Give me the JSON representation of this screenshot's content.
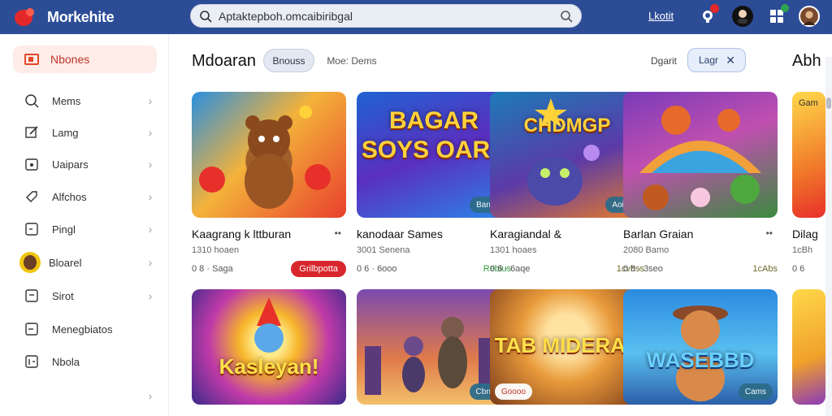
{
  "header": {
    "brand": "Morkehite",
    "search_value": "Aptaktepboh.omcaibiribgal",
    "link": "Lkotit"
  },
  "sidebar": {
    "active": "Nbones",
    "items": [
      {
        "label": "Mems",
        "icon": "search-icon"
      },
      {
        "label": "Lamg",
        "icon": "edit-icon"
      },
      {
        "label": "Uaipars",
        "icon": "calendar-icon"
      },
      {
        "label": "Alfchos",
        "icon": "tag-icon"
      },
      {
        "label": "Pingl",
        "icon": "square-icon"
      },
      {
        "label": "Bloarel",
        "icon": "avatar-icon"
      },
      {
        "label": "Sirot",
        "icon": "box-icon"
      },
      {
        "label": "Menegbiatos",
        "icon": "minus-box-icon"
      },
      {
        "label": "Nbola",
        "icon": "grid-icon"
      },
      {
        "label": "",
        "icon": ""
      }
    ]
  },
  "main": {
    "title": "Mdoaran",
    "chip_active": "Bnouss",
    "chip_plain": "Moe: Dems",
    "filter_label": "Dgarit",
    "filter_chip": "Lagr",
    "right_title": "Abh"
  },
  "cards": [
    {
      "name": "Kaagrang k lttburan",
      "sub": "1310 hoaen",
      "meta": "0 8 · Saga",
      "status": "Grilbpotta",
      "status_style": "btn",
      "tag": "",
      "word": "",
      "more": "••"
    },
    {
      "name": "kanodaar Sames",
      "sub": "3001 Senena",
      "meta": "0 6 · 6ooo",
      "status": "Reblus",
      "status_style": "green",
      "tag": "Barms",
      "word": "BAGAR SOYS OARS",
      "more": ""
    },
    {
      "name": "Karagiandal &",
      "sub": "1301 hoaes",
      "meta": "0 6 · 6aqe",
      "status": "1cvhss",
      "status_style": "olive",
      "tag": "Aoine",
      "word": "CHDMGP",
      "more": ""
    },
    {
      "name": "Barlan Graian",
      "sub": "2080 Bamo",
      "meta": "0 8 · 3seo",
      "status": "1cAbs",
      "status_style": "olive",
      "tag": "",
      "word": "",
      "more": "••"
    },
    {
      "name": "",
      "sub": "",
      "meta": "",
      "status": "",
      "status_style": "",
      "tag": "",
      "word": "Kasleyan!",
      "more": ""
    },
    {
      "name": "",
      "sub": "",
      "meta": "",
      "status": "",
      "status_style": "",
      "tag": "Cbrms",
      "word": "",
      "more": ""
    },
    {
      "name": "",
      "sub": "",
      "meta": "",
      "status": "",
      "status_style": "",
      "tag": "Goooo",
      "word": "TAB MIDERAS",
      "more": ""
    },
    {
      "name": "",
      "sub": "",
      "meta": "",
      "status": "",
      "status_style": "",
      "tag": "Cams",
      "word": "WASEBBD",
      "more": ""
    }
  ],
  "edge_card": {
    "label": "Gam",
    "name": "Dilag",
    "sub": "1cBh",
    "meta": "0 6"
  }
}
